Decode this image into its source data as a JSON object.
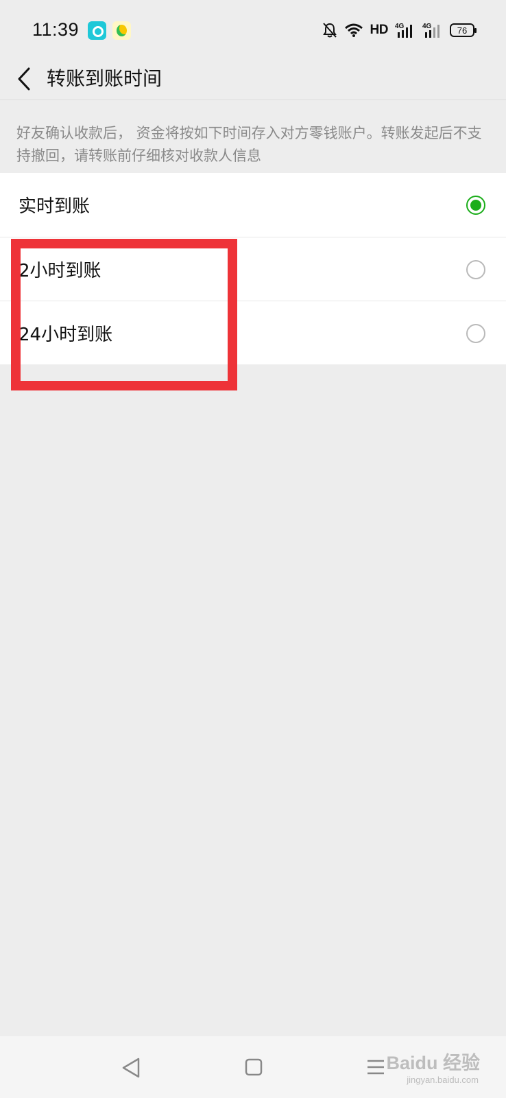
{
  "status_bar": {
    "time": "11:39",
    "app_icons": [
      "tv-app-icon",
      "music-app-icon"
    ],
    "hd_label": "HD",
    "network_1": "4G",
    "network_2": "4G",
    "battery": "76"
  },
  "header": {
    "title": "转账到账时间"
  },
  "notice": {
    "text": "好友确认收款后， 资金将按如下时间存入对方零钱账户。转账发起后不支持撤回，请转账前仔细核对收款人信息"
  },
  "options": [
    {
      "label": "实时到账",
      "selected": true
    },
    {
      "label": "2小时到账",
      "selected": false
    },
    {
      "label": "24小时到账",
      "selected": false
    }
  ],
  "colors": {
    "accent": "#1aad19",
    "highlight": "#ee3338",
    "background": "#ededed"
  },
  "watermark": {
    "text": "Baidu 经验",
    "sub": "jingyan.baidu.com"
  }
}
